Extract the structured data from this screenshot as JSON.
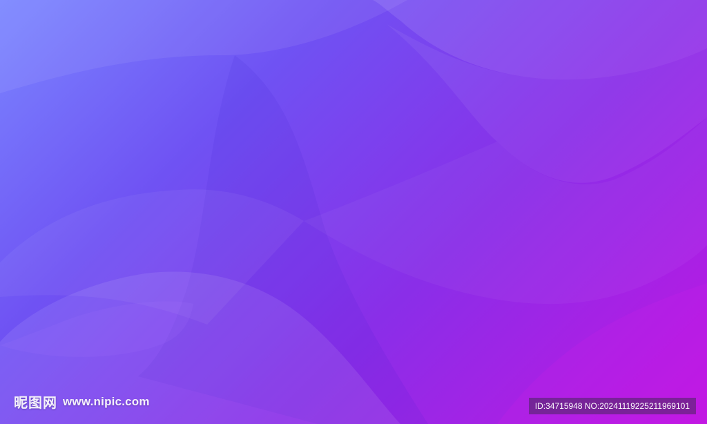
{
  "watermark": {
    "site_name": "昵图网",
    "site_url": "www.nipic.com",
    "id_text": "ID:34715948 NO:20241119225211969101"
  },
  "colors": {
    "gradient_start": "#7a86ff",
    "gradient_mid": "#7a2cf0",
    "gradient_end": "#c016e2"
  }
}
